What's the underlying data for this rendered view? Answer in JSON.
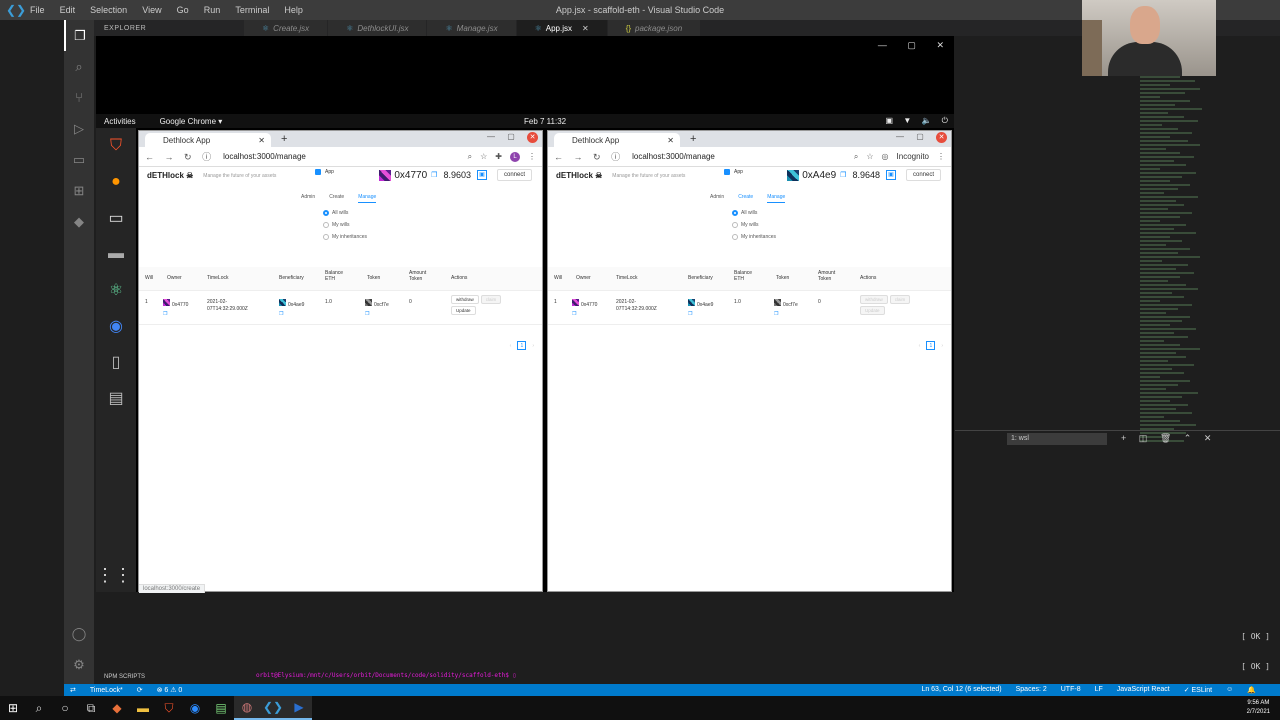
{
  "vscode": {
    "menu": [
      "File",
      "Edit",
      "Selection",
      "View",
      "Go",
      "Run",
      "Terminal",
      "Help"
    ],
    "window_title": "App.jsx - scaffold-eth - Visual Studio Code",
    "explorer_label": "EXPLORER",
    "tabs": [
      {
        "label": "Create.jsx",
        "active": false
      },
      {
        "label": "DethlockUI.jsx",
        "active": false
      },
      {
        "label": "Manage.jsx",
        "active": false
      },
      {
        "label": "App.jsx",
        "active": true
      },
      {
        "label": "package.json",
        "active": false
      }
    ],
    "terminal_select": "1: wsl",
    "ok1": "[ OK ]",
    "ok2": "[ OK ]",
    "npm_scripts": "NPM SCRIPTS",
    "terminal_line": "orbit@Elysium:/mnt/c/Users/orbit/Documents/code/solidity/scaffold-eth$ ▯",
    "status": {
      "branch": "TimeLock*",
      "sync": "⟳",
      "problems": "⊗ 6 ⚠ 0",
      "position": "Ln 63, Col 12 (6 selected)",
      "spaces": "Spaces: 2",
      "encoding": "UTF-8",
      "eol": "LF",
      "language": "JavaScript React",
      "linter": "✓ ESLint"
    }
  },
  "taskbar": {
    "time": "9:56 AM",
    "date": "2/7/2021"
  },
  "ubuntu": {
    "activities": "Activities",
    "app": "Google Chrome ▾",
    "clock": "Feb 7  11:32"
  },
  "left_browser": {
    "tab_title": "Dethlock App",
    "url": "localhost:3000/manage",
    "profile_initial": "L",
    "status_url": "localhost:3000/create",
    "app": {
      "brand": "dETHlock ☠",
      "tagline": "Manage the future of your assets",
      "app_label": "App",
      "address": "0x4770",
      "balance": "8.9603",
      "connect": "connect",
      "nav": [
        "Admin",
        "Create",
        "Manage"
      ],
      "filters": [
        "All wills",
        "My wills",
        "My inheritances"
      ],
      "columns": [
        "Will",
        "Owner",
        "TimeLock",
        "Beneficiary",
        "Balance ETH",
        "Token",
        "Amount Token",
        "Actions"
      ],
      "row": {
        "will": "1",
        "owner": "0x4770",
        "timelock": "2021-02-07T14:32:29.000Z",
        "beneficiary": "0x4ae9",
        "balance": "1.0",
        "token": "0xcf7e",
        "amount": "0",
        "actions": [
          "withdraw",
          "claim",
          "Update"
        ]
      },
      "page": "1"
    }
  },
  "right_browser": {
    "tab_title": "Dethlock App",
    "url": "localhost:3000/manage",
    "incognito": "Incognito",
    "app": {
      "brand": "dETHlock ☠",
      "tagline": "Manage the future of your assets",
      "app_label": "App",
      "address": "0xA4e9",
      "balance": "8.9648",
      "connect": "connect",
      "nav": [
        "Admin",
        "Create",
        "Manage"
      ],
      "filters": [
        "All wills",
        "My wills",
        "My inheritances"
      ],
      "columns": [
        "Will",
        "Owner",
        "TimeLock",
        "Beneficiary",
        "Balance ETH",
        "Token",
        "Amount Token",
        "Actions"
      ],
      "row": {
        "will": "1",
        "owner": "0x4770",
        "timelock": "2021-02-07T14:32:29.000Z",
        "beneficiary": "0x4ae9",
        "balance": "1.0",
        "token": "0xcf7e",
        "amount": "0",
        "actions": [
          "withdraw",
          "claim",
          "Update"
        ]
      },
      "page": "1"
    }
  }
}
